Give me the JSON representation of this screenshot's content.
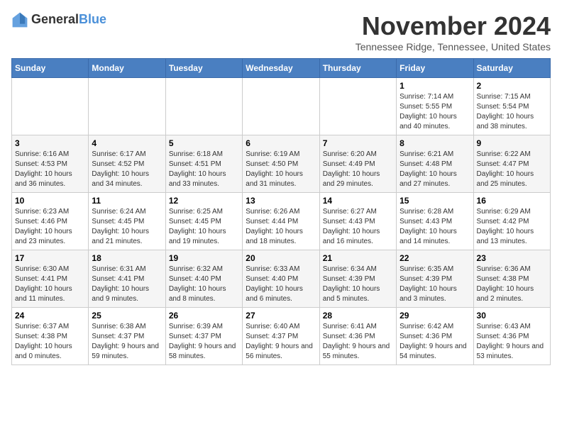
{
  "logo": {
    "general": "General",
    "blue": "Blue"
  },
  "title": "November 2024",
  "location": "Tennessee Ridge, Tennessee, United States",
  "days_of_week": [
    "Sunday",
    "Monday",
    "Tuesday",
    "Wednesday",
    "Thursday",
    "Friday",
    "Saturday"
  ],
  "weeks": [
    [
      {
        "day": "",
        "info": ""
      },
      {
        "day": "",
        "info": ""
      },
      {
        "day": "",
        "info": ""
      },
      {
        "day": "",
        "info": ""
      },
      {
        "day": "",
        "info": ""
      },
      {
        "day": "1",
        "info": "Sunrise: 7:14 AM\nSunset: 5:55 PM\nDaylight: 10 hours and 40 minutes."
      },
      {
        "day": "2",
        "info": "Sunrise: 7:15 AM\nSunset: 5:54 PM\nDaylight: 10 hours and 38 minutes."
      }
    ],
    [
      {
        "day": "3",
        "info": "Sunrise: 6:16 AM\nSunset: 4:53 PM\nDaylight: 10 hours and 36 minutes."
      },
      {
        "day": "4",
        "info": "Sunrise: 6:17 AM\nSunset: 4:52 PM\nDaylight: 10 hours and 34 minutes."
      },
      {
        "day": "5",
        "info": "Sunrise: 6:18 AM\nSunset: 4:51 PM\nDaylight: 10 hours and 33 minutes."
      },
      {
        "day": "6",
        "info": "Sunrise: 6:19 AM\nSunset: 4:50 PM\nDaylight: 10 hours and 31 minutes."
      },
      {
        "day": "7",
        "info": "Sunrise: 6:20 AM\nSunset: 4:49 PM\nDaylight: 10 hours and 29 minutes."
      },
      {
        "day": "8",
        "info": "Sunrise: 6:21 AM\nSunset: 4:48 PM\nDaylight: 10 hours and 27 minutes."
      },
      {
        "day": "9",
        "info": "Sunrise: 6:22 AM\nSunset: 4:47 PM\nDaylight: 10 hours and 25 minutes."
      }
    ],
    [
      {
        "day": "10",
        "info": "Sunrise: 6:23 AM\nSunset: 4:46 PM\nDaylight: 10 hours and 23 minutes."
      },
      {
        "day": "11",
        "info": "Sunrise: 6:24 AM\nSunset: 4:45 PM\nDaylight: 10 hours and 21 minutes."
      },
      {
        "day": "12",
        "info": "Sunrise: 6:25 AM\nSunset: 4:45 PM\nDaylight: 10 hours and 19 minutes."
      },
      {
        "day": "13",
        "info": "Sunrise: 6:26 AM\nSunset: 4:44 PM\nDaylight: 10 hours and 18 minutes."
      },
      {
        "day": "14",
        "info": "Sunrise: 6:27 AM\nSunset: 4:43 PM\nDaylight: 10 hours and 16 minutes."
      },
      {
        "day": "15",
        "info": "Sunrise: 6:28 AM\nSunset: 4:43 PM\nDaylight: 10 hours and 14 minutes."
      },
      {
        "day": "16",
        "info": "Sunrise: 6:29 AM\nSunset: 4:42 PM\nDaylight: 10 hours and 13 minutes."
      }
    ],
    [
      {
        "day": "17",
        "info": "Sunrise: 6:30 AM\nSunset: 4:41 PM\nDaylight: 10 hours and 11 minutes."
      },
      {
        "day": "18",
        "info": "Sunrise: 6:31 AM\nSunset: 4:41 PM\nDaylight: 10 hours and 9 minutes."
      },
      {
        "day": "19",
        "info": "Sunrise: 6:32 AM\nSunset: 4:40 PM\nDaylight: 10 hours and 8 minutes."
      },
      {
        "day": "20",
        "info": "Sunrise: 6:33 AM\nSunset: 4:40 PM\nDaylight: 10 hours and 6 minutes."
      },
      {
        "day": "21",
        "info": "Sunrise: 6:34 AM\nSunset: 4:39 PM\nDaylight: 10 hours and 5 minutes."
      },
      {
        "day": "22",
        "info": "Sunrise: 6:35 AM\nSunset: 4:39 PM\nDaylight: 10 hours and 3 minutes."
      },
      {
        "day": "23",
        "info": "Sunrise: 6:36 AM\nSunset: 4:38 PM\nDaylight: 10 hours and 2 minutes."
      }
    ],
    [
      {
        "day": "24",
        "info": "Sunrise: 6:37 AM\nSunset: 4:38 PM\nDaylight: 10 hours and 0 minutes."
      },
      {
        "day": "25",
        "info": "Sunrise: 6:38 AM\nSunset: 4:37 PM\nDaylight: 9 hours and 59 minutes."
      },
      {
        "day": "26",
        "info": "Sunrise: 6:39 AM\nSunset: 4:37 PM\nDaylight: 9 hours and 58 minutes."
      },
      {
        "day": "27",
        "info": "Sunrise: 6:40 AM\nSunset: 4:37 PM\nDaylight: 9 hours and 56 minutes."
      },
      {
        "day": "28",
        "info": "Sunrise: 6:41 AM\nSunset: 4:36 PM\nDaylight: 9 hours and 55 minutes."
      },
      {
        "day": "29",
        "info": "Sunrise: 6:42 AM\nSunset: 4:36 PM\nDaylight: 9 hours and 54 minutes."
      },
      {
        "day": "30",
        "info": "Sunrise: 6:43 AM\nSunset: 4:36 PM\nDaylight: 9 hours and 53 minutes."
      }
    ]
  ]
}
